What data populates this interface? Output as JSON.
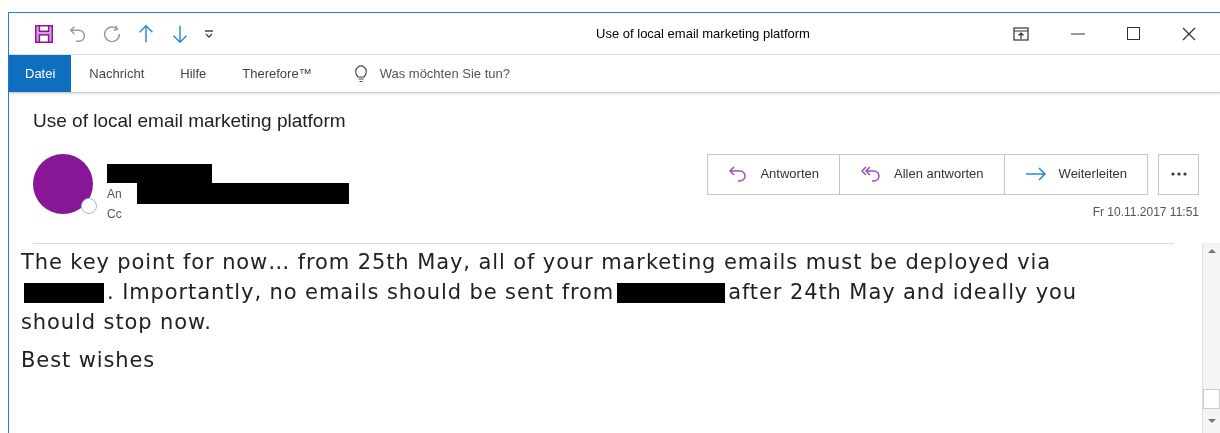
{
  "window": {
    "title": "Use of local email marketing platform"
  },
  "quick_access": [
    {
      "kind": "save"
    },
    {
      "kind": "undo",
      "disabled": true
    },
    {
      "kind": "redo",
      "disabled": true
    },
    {
      "kind": "up",
      "disabled": false
    },
    {
      "kind": "down",
      "disabled": false
    },
    {
      "kind": "customize"
    }
  ],
  "ribbon_tabs": [
    {
      "label": "Datei",
      "selected": true
    },
    {
      "label": "Nachricht",
      "selected": false
    },
    {
      "label": "Hilfe",
      "selected": false
    },
    {
      "label": "Therefore™",
      "selected": false
    }
  ],
  "tell_me": {
    "placeholder": "Was möchten Sie tun?"
  },
  "message": {
    "subject": "Use of local email marketing platform",
    "to_label": "An",
    "cc_label": "Cc",
    "date": "Fr 10.11.2017 11:51",
    "actions": [
      {
        "kind": "reply",
        "label": "Antworten"
      },
      {
        "kind": "reply_all",
        "label": "Allen antworten"
      },
      {
        "kind": "forward",
        "label": "Weiterleiten"
      }
    ],
    "body": [
      {
        "lines": [
          [
            {
              "kind": "text",
              "text": "The key point for now… from 25th May, all of your marketing emails must be deployed via"
            }
          ],
          [
            {
              "kind": "redacted"
            },
            {
              "kind": "text",
              "text": ". Importantly, no emails should be sent from"
            },
            {
              "kind": "redacted"
            },
            {
              "kind": "text",
              "text": "after 24th May and ideally you"
            }
          ],
          [
            {
              "kind": "text",
              "text": "should stop now."
            }
          ]
        ]
      },
      {
        "lines": [
          [
            {
              "kind": "text",
              "text": "Best wishes"
            }
          ]
        ]
      }
    ]
  }
}
